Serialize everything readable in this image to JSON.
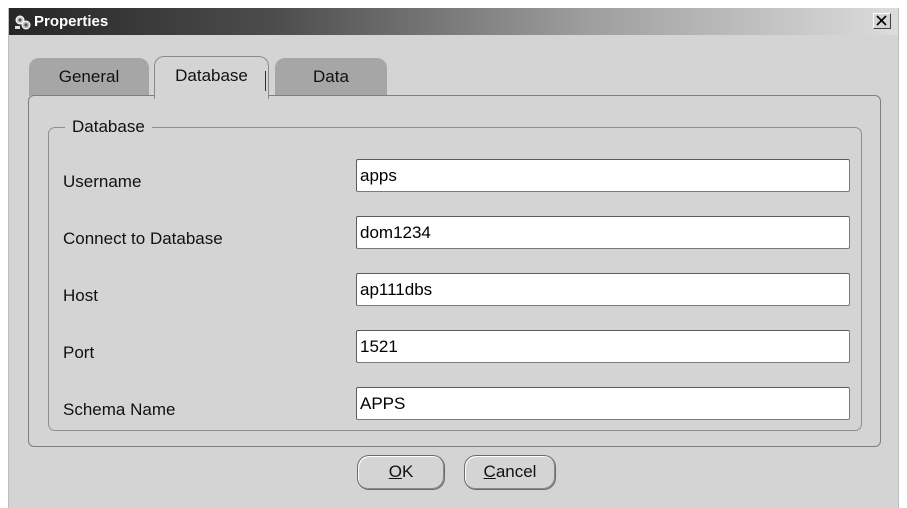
{
  "window": {
    "title": "Properties",
    "close_glyph": "×",
    "icon": "properties-icon"
  },
  "tabs": [
    {
      "label": "General",
      "active": false
    },
    {
      "label": "Database",
      "active": true
    },
    {
      "label": "Data",
      "active": false
    }
  ],
  "group": {
    "label": "Database"
  },
  "fields": [
    {
      "label": "Username",
      "value": "apps"
    },
    {
      "label": "Connect to Database",
      "value": "dom1234"
    },
    {
      "label": "Host",
      "value": "ap111dbs"
    },
    {
      "label": "Port",
      "value": "1521"
    },
    {
      "label": "Schema Name",
      "value": "APPS"
    }
  ],
  "buttons": {
    "ok": {
      "mnemonic": "O",
      "rest": "K"
    },
    "cancel": {
      "mnemonic": "C",
      "rest": "ancel"
    }
  }
}
